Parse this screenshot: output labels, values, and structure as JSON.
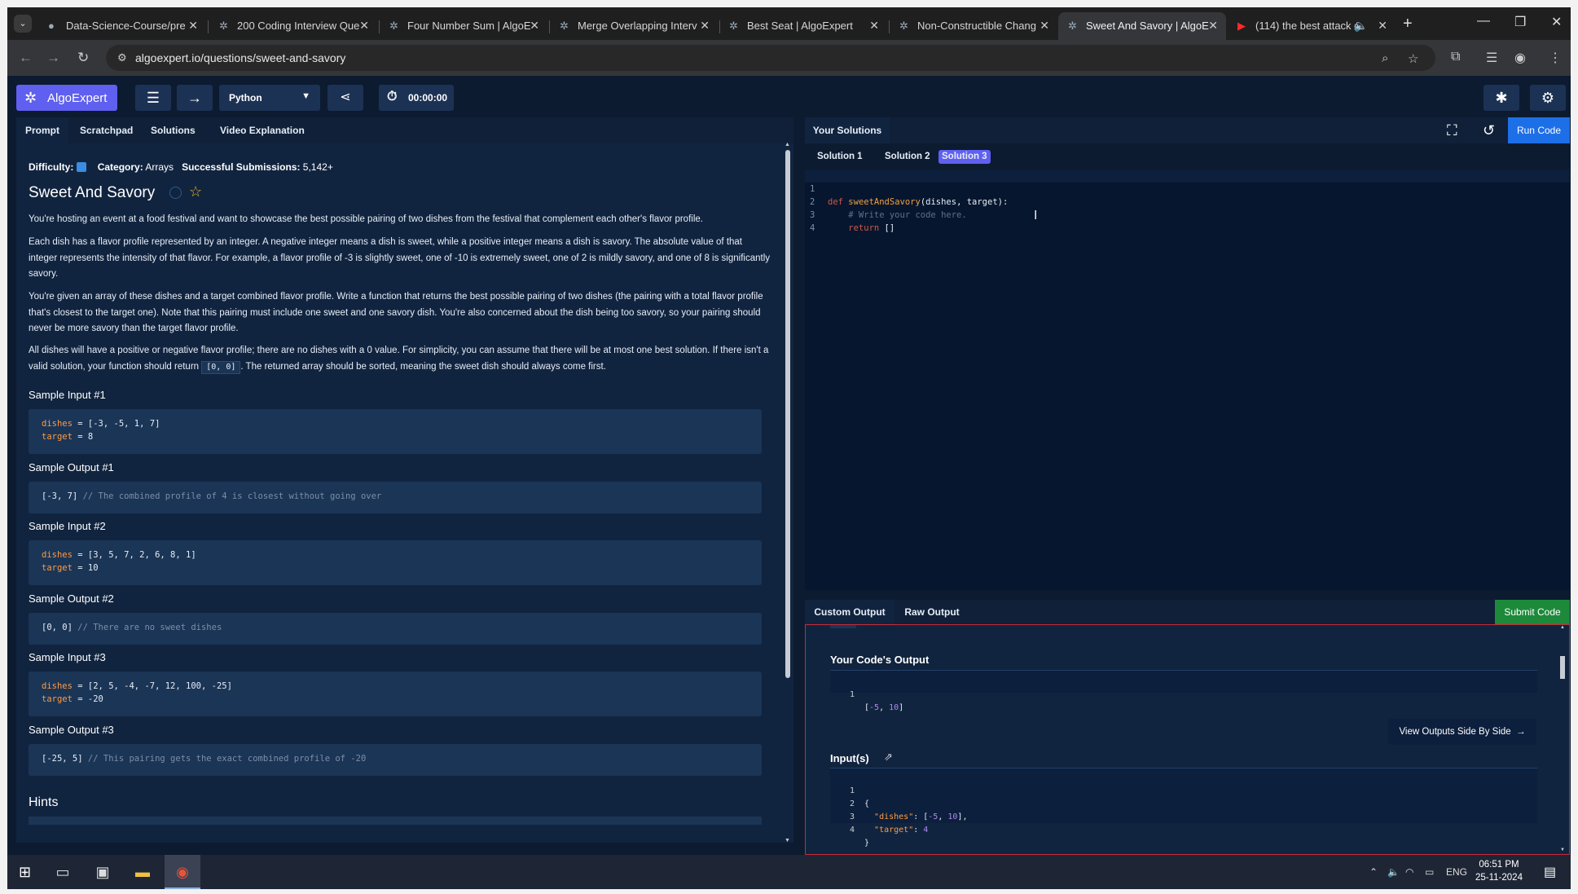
{
  "browser": {
    "tabs": [
      {
        "title": "Data-Science-Course/pre"
      },
      {
        "title": "200 Coding Interview Que"
      },
      {
        "title": "Four Number Sum | AlgoE"
      },
      {
        "title": "Merge Overlapping Interv"
      },
      {
        "title": "Best Seat | AlgoExpert"
      },
      {
        "title": "Non-Constructible Chang"
      },
      {
        "title": "Sweet And Savory | AlgoE"
      },
      {
        "title": "(114) the best attack c"
      }
    ],
    "url": "algoexpert.io/questions/sweet-and-savory"
  },
  "app": {
    "logo_text": "AlgoExpert",
    "language": "Python",
    "timer": "00:00:00"
  },
  "prompt": {
    "tabs": [
      "Prompt",
      "Scratchpad",
      "Solutions",
      "Video Explanation"
    ],
    "difficulty_label": "Difficulty:",
    "category_label": "Category:",
    "category_value": "Arrays",
    "submissions_label": "Successful Submissions:",
    "submissions_value": "5,142+",
    "title": "Sweet And Savory",
    "p1": "You're hosting an event at a food festival and want to showcase the best possible pairing of two dishes from the festival that complement each other's flavor profile.",
    "p2": "Each dish has a flavor profile represented by an integer. A negative integer means a dish is sweet, while a positive integer means a dish is savory. The absolute value of that integer represents the intensity of that flavor. For example, a flavor profile of -3 is slightly sweet, one of -10 is extremely sweet, one of 2 is mildly savory, and one of 8 is significantly savory.",
    "p3": "You're given an array of these dishes and a target combined flavor profile. Write a function that returns the best possible pairing of two dishes (the pairing with a total flavor profile that's closest to the target one). Note that this pairing must include one sweet and one savory dish. You're also concerned about the dish being too savory, so your pairing should never be more savory than the target flavor profile.",
    "p4_a": "All dishes will have a positive or negative flavor profile; there are no dishes with a 0 value. For simplicity, you can assume that there will be at most one best solution. If there isn't a valid solution, your function should return",
    "p4_code": "[0, 0]",
    "p4_b": ". The returned array should be sorted, meaning the sweet dish should always come first.",
    "samples": [
      {
        "in_title": "Sample Input #1",
        "dishes_key": "dishes",
        "dishes_val": " = [-3, -5, 1, 7]",
        "target_key": "target",
        "target_val": " = 8",
        "out_title": "Sample Output #1",
        "out_val": "[-3, 7] ",
        "out_cmt": "// The combined profile of 4 is closest without going over"
      },
      {
        "in_title": "Sample Input #2",
        "dishes_key": "dishes",
        "dishes_val": " = [3, 5, 7, 2, 6, 8, 1]",
        "target_key": "target",
        "target_val": " = 10",
        "out_title": "Sample Output #2",
        "out_val": "[0, 0] ",
        "out_cmt": "// There are no sweet dishes"
      },
      {
        "in_title": "Sample Input #3",
        "dishes_key": "dishes",
        "dishes_val": " = [2, 5, -4, -7, 12, 100, -25]",
        "target_key": "target",
        "target_val": " = -20",
        "out_title": "Sample Output #3",
        "out_val": "[-25, 5] ",
        "out_cmt": "// This pairing gets the exact combined profile of -20"
      }
    ],
    "hints_title": "Hints"
  },
  "editor": {
    "tab_label": "Your Solutions",
    "run_label": "Run Code",
    "solution_tabs": [
      "Solution 1",
      "Solution 2",
      "Solution 3"
    ],
    "lines": [
      {
        "n": "1",
        "kw": "def ",
        "fn": "sweetAndSavory",
        "rest": "(dishes, target):"
      },
      {
        "n": "2",
        "cm": "    # Write your code here."
      },
      {
        "n": "3",
        "kw": "    return ",
        "rest": "[]"
      },
      {
        "n": "4",
        "rest": ""
      }
    ]
  },
  "output": {
    "tabs": [
      "Custom Output",
      "Raw Output"
    ],
    "submit_label": "Submit Code",
    "code_output_title": "Your Code's Output",
    "code_output": {
      "n": "1",
      "a": "[",
      "v1": "-5",
      "b": ", ",
      "v2": "10",
      "c": "]"
    },
    "side_by_side_label": "View Outputs Side By Side",
    "inputs_title": "Input(s)",
    "inputs": [
      {
        "n": "1",
        "text": "{"
      },
      {
        "n": "2",
        "key": "\"dishes\"",
        "mid": ": [",
        "v1": "-5",
        "sep": ", ",
        "v2": "10",
        "end": "],"
      },
      {
        "n": "3",
        "key": "\"target\"",
        "mid": ": ",
        "v1": "4"
      },
      {
        "n": "4",
        "text": "}"
      }
    ]
  },
  "taskbar": {
    "lang": "ENG",
    "time": "06:51 PM",
    "date": "25-11-2024"
  }
}
